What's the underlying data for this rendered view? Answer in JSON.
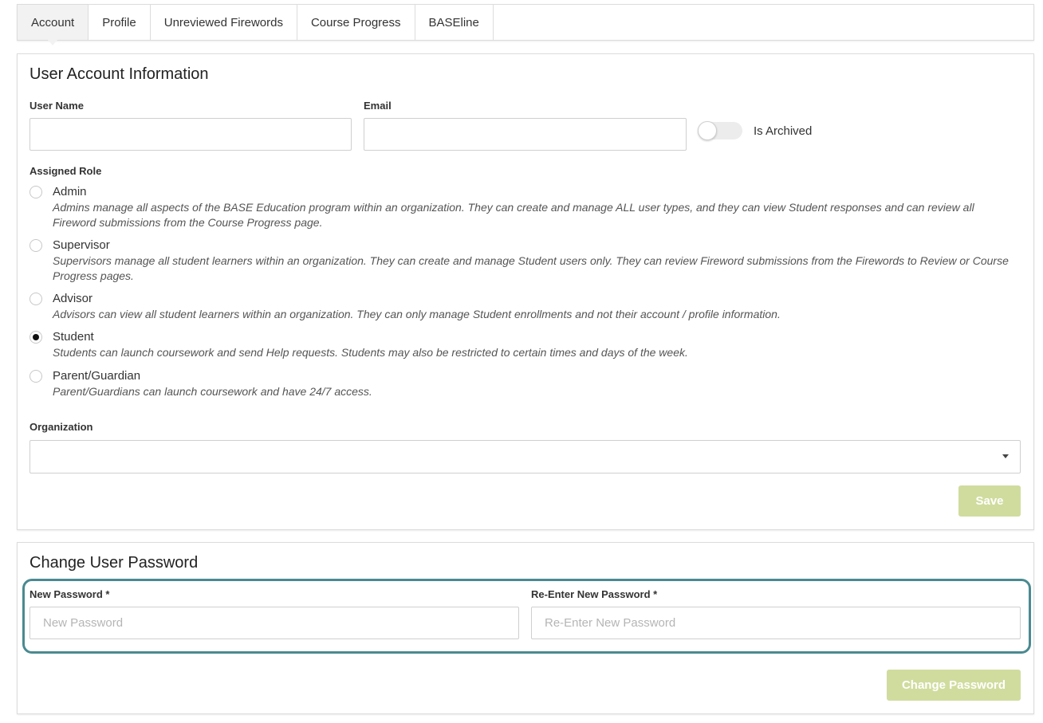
{
  "tabs": [
    {
      "label": "Account",
      "active": true
    },
    {
      "label": "Profile",
      "active": false
    },
    {
      "label": "Unreviewed Firewords",
      "active": false
    },
    {
      "label": "Course Progress",
      "active": false
    },
    {
      "label": "BASEline",
      "active": false
    }
  ],
  "account": {
    "title": "User Account Information",
    "username": {
      "label": "User Name",
      "value": ""
    },
    "email": {
      "label": "Email",
      "value": ""
    },
    "archived": {
      "label": "Is Archived",
      "checked": false
    },
    "role_label": "Assigned Role",
    "roles": [
      {
        "name": "Admin",
        "description": "Admins manage all aspects of the BASE Education program within an organization. They can create and manage ALL user types, and they can view Student responses and can review all Fireword submissions from the Course Progress page.",
        "selected": false
      },
      {
        "name": "Supervisor",
        "description": "Supervisors manage all student learners within an organization. They can create and manage Student users only. They can review Fireword submissions from the Firewords to Review or Course Progress pages.",
        "selected": false
      },
      {
        "name": "Advisor",
        "description": "Advisors can view all student learners within an organization. They can only manage Student enrollments and not their account / profile information.",
        "selected": false
      },
      {
        "name": "Student",
        "description": "Students can launch coursework and send Help requests. Students may also be restricted to certain times and days of the week.",
        "selected": true
      },
      {
        "name": "Parent/Guardian",
        "description": "Parent/Guardians can launch coursework and have 24/7 access.",
        "selected": false
      }
    ],
    "organization": {
      "label": "Organization",
      "value": ""
    },
    "save_label": "Save"
  },
  "password": {
    "title": "Change User Password",
    "new": {
      "label": "New Password *",
      "placeholder": "New Password"
    },
    "confirm": {
      "label": "Re-Enter New Password *",
      "placeholder": "Re-Enter New Password"
    },
    "button_label": "Change Password"
  },
  "colors": {
    "button": "#d0dc9e",
    "highlight": "#4a8a90"
  }
}
